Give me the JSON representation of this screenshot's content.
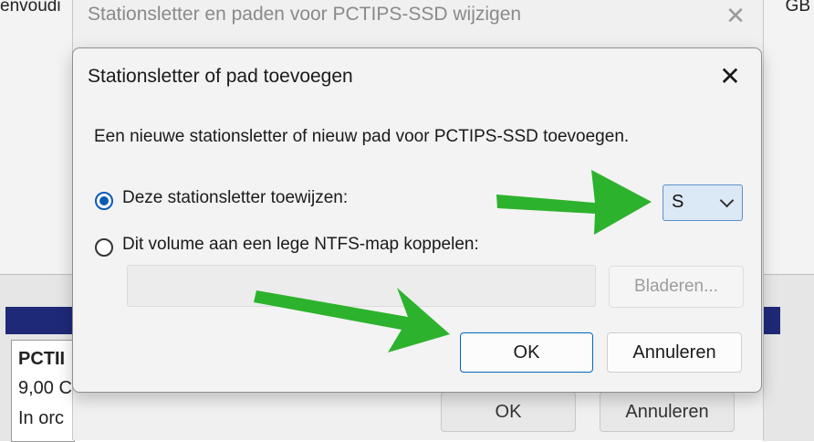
{
  "background": {
    "left_text": "envoudi",
    "right_text": "GB",
    "volume_name": "PCTII",
    "volume_size": "9,00 C",
    "volume_status": "In orc"
  },
  "parent_dialog": {
    "title": "Stationsletter en paden voor PCTIPS-SSD wijzigen",
    "close_icon": "✕",
    "ok_label": "OK",
    "cancel_label": "Annuleren"
  },
  "dialog": {
    "title": "Stationsletter of pad toevoegen",
    "close_icon": "✕",
    "description": "Een nieuwe stationsletter of nieuw pad voor PCTIPS-SSD toevoegen.",
    "option_assign_letter": "Deze stationsletter toewijzen:",
    "option_mount_folder": "Dit volume aan een lege NTFS-map koppelen:",
    "selected_option": "assign_letter",
    "drive_letter": "S",
    "path_value": "",
    "browse_label": "Bladeren...",
    "ok_label": "OK",
    "cancel_label": "Annuleren"
  },
  "colors": {
    "accent": "#0a5ab4",
    "arrow": "#2db22d",
    "navy_bar": "#1e2a78"
  }
}
